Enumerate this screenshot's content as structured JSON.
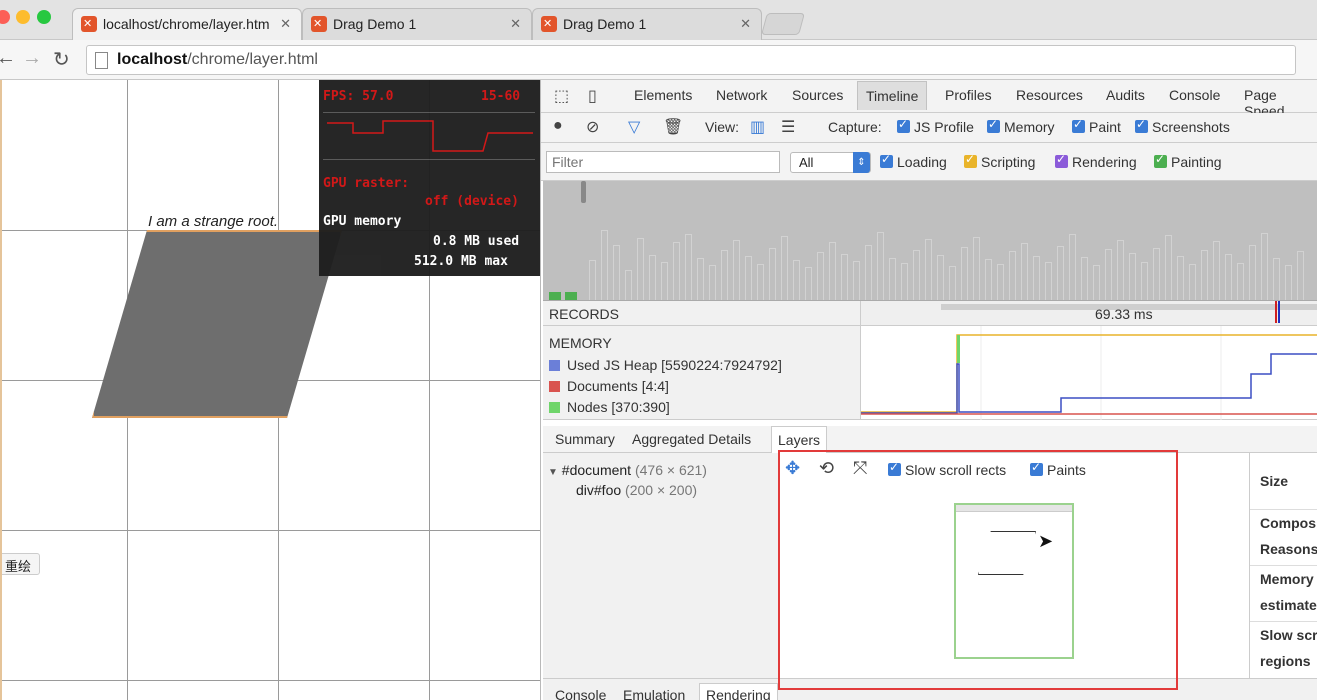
{
  "browser": {
    "tabs": [
      {
        "title": "localhost/chrome/layer.htm",
        "active": true
      },
      {
        "title": "Drag Demo 1",
        "active": false
      },
      {
        "title": "Drag Demo 1",
        "active": false
      }
    ],
    "url_host": "localhost",
    "url_path": "/chrome/layer.html"
  },
  "page": {
    "shape_text": "I am a strange root.",
    "side_button": "重绘",
    "hud": {
      "fps": "FPS: 57.0",
      "range": "15-60",
      "gpu_raster": "GPU raster:",
      "gpu_raster_state": "off (device)",
      "gpu_memory": "GPU memory",
      "used": "0.8 MB used",
      "max": "512.0 MB max"
    }
  },
  "devtools": {
    "tabs": [
      "Elements",
      "Network",
      "Sources",
      "Timeline",
      "Profiles",
      "Resources",
      "Audits",
      "Console",
      "Page Speed"
    ],
    "active_tab": "Timeline",
    "view_label": "View:",
    "capture_label": "Capture:",
    "capture": [
      "JS Profile",
      "Memory",
      "Paint",
      "Screenshots"
    ],
    "filter_placeholder": "Filter",
    "filter_select": "All",
    "categories": [
      {
        "label": "Loading",
        "color": "#3a7bd5"
      },
      {
        "label": "Scripting",
        "color": "#e9b42a"
      },
      {
        "label": "Rendering",
        "color": "#8b5bd9"
      },
      {
        "label": "Painting",
        "color": "#4caf50"
      }
    ],
    "records_label": "RECORDS",
    "ruler_time": "69.33 ms",
    "memory": {
      "title": "MEMORY",
      "rows": [
        {
          "label": "Used JS Heap [5590224:7924792]",
          "color": "#6b7fd8"
        },
        {
          "label": "Documents [4:4]",
          "color": "#d9534f"
        },
        {
          "label": "Nodes [370:390]",
          "color": "#6fd56a"
        }
      ]
    },
    "details_tabs": [
      "Summary",
      "Aggregated Details",
      "Layers"
    ],
    "active_details_tab": "Layers",
    "layer_tree": [
      {
        "name": "#document",
        "size": "(476 × 621)"
      },
      {
        "name": "div#foo",
        "size": "(200 × 200)"
      }
    ],
    "layer_toolbar": {
      "slow_scroll": "Slow scroll rects",
      "paints": "Paints"
    },
    "props": [
      "Size",
      "Compos",
      "Reasons",
      "Memory",
      "estimate",
      "Slow scr",
      "regions"
    ],
    "drawer_tabs": [
      "Console",
      "Emulation",
      "Rendering"
    ],
    "active_drawer_tab": "Rendering"
  }
}
